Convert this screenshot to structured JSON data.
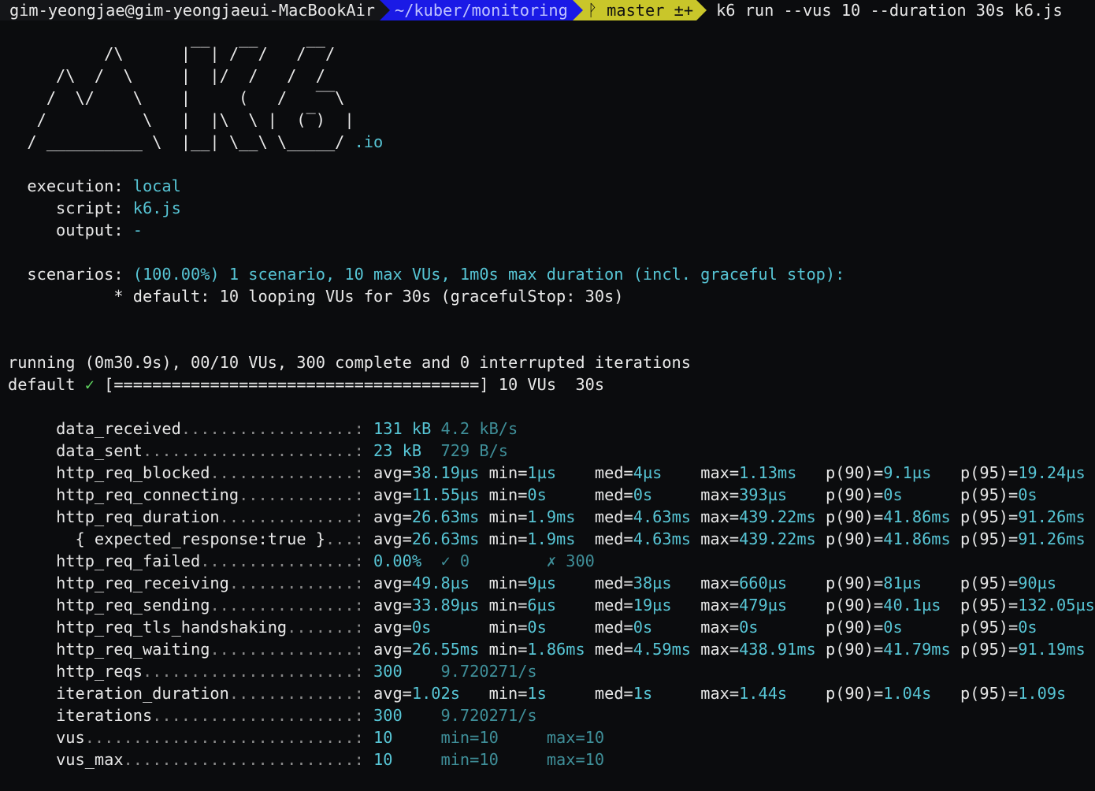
{
  "prompt": {
    "user_host": "gim-yeongjae@gim-yeongjaeui-MacBookAir",
    "path": "~/kuber/monitoring",
    "branch_icon": "git-branch-icon",
    "branch": "ᚹ master ±+",
    "command": "k6 run --vus 10 --duration 30s k6.js"
  },
  "logo": {
    "lines": [
      "          /\\      |‾‾| /‾‾/   /‾‾/",
      "     /\\  /  \\     |  |/  /   /  /",
      "    /  \\/    \\    |     (   /   ‾‾\\",
      "   /          \\   |  |\\  \\ |  (‾)  |",
      "  / __________ \\  |__| \\__\\ \\_____/"
    ],
    "suffix": ".io"
  },
  "summary": {
    "execution_label": "  execution:",
    "execution_value": "local",
    "script_label": "     script:",
    "script_value": "k6.js",
    "output_label": "     output:",
    "output_value": "-",
    "scenarios_label": "  scenarios:",
    "scenarios_value": "(100.00%) 1 scenario, 10 max VUs, 1m0s max duration (incl. graceful stop):",
    "scenario_detail": "           * default: 10 looping VUs for 30s (gracefulStop: 30s)"
  },
  "progress": {
    "running": "running (0m30.9s), 00/10 VUs, 300 complete and 0 interrupted iterations",
    "name": "default",
    "check": "✓",
    "bar": "[======================================]",
    "tail": " 10 VUs  30s",
    "fraction": 1.0
  },
  "metrics": [
    {
      "name": "data_received",
      "dots": "..................:",
      "cols": [
        {
          "t": "131 kB",
          "w": 7,
          "cls": "c"
        },
        {
          "t": "4.2 kB/s",
          "w": 0,
          "cls": "d"
        }
      ]
    },
    {
      "name": "data_sent",
      "dots": "......................:",
      "cols": [
        {
          "t": "23 kB",
          "w": 7,
          "cls": "c"
        },
        {
          "t": "729 B/s",
          "w": 0,
          "cls": "d"
        }
      ]
    },
    {
      "name": "http_req_blocked",
      "dots": "...............:",
      "cols": [
        {
          "k": "avg=",
          "v": "38.19µs",
          "w": 12
        },
        {
          "k": "min=",
          "v": "1µs",
          "w": 11
        },
        {
          "k": "med=",
          "v": "4µs",
          "w": 11
        },
        {
          "k": "max=",
          "v": "1.13ms",
          "w": 13
        },
        {
          "k": "p(90)=",
          "v": "9.1µs",
          "w": 14
        },
        {
          "k": "p(95)=",
          "v": "19.24µs",
          "w": 0
        }
      ]
    },
    {
      "name": "http_req_connecting",
      "dots": "............:",
      "cols": [
        {
          "k": "avg=",
          "v": "11.55µs",
          "w": 12
        },
        {
          "k": "min=",
          "v": "0s",
          "w": 11
        },
        {
          "k": "med=",
          "v": "0s",
          "w": 11
        },
        {
          "k": "max=",
          "v": "393µs",
          "w": 13
        },
        {
          "k": "p(90)=",
          "v": "0s",
          "w": 14
        },
        {
          "k": "p(95)=",
          "v": "0s",
          "w": 0
        }
      ]
    },
    {
      "name": "http_req_duration",
      "dots": "..............:",
      "cols": [
        {
          "k": "avg=",
          "v": "26.63ms",
          "w": 12
        },
        {
          "k": "min=",
          "v": "1.9ms",
          "w": 11
        },
        {
          "k": "med=",
          "v": "4.63ms",
          "w": 11
        },
        {
          "k": "max=",
          "v": "439.22ms",
          "w": 13
        },
        {
          "k": "p(90)=",
          "v": "41.86ms",
          "w": 14
        },
        {
          "k": "p(95)=",
          "v": "91.26ms",
          "w": 0
        }
      ]
    },
    {
      "name": "  { expected_response:true }",
      "dots": "...:",
      "cols": [
        {
          "k": "avg=",
          "v": "26.63ms",
          "w": 12
        },
        {
          "k": "min=",
          "v": "1.9ms",
          "w": 11
        },
        {
          "k": "med=",
          "v": "4.63ms",
          "w": 11
        },
        {
          "k": "max=",
          "v": "439.22ms",
          "w": 13
        },
        {
          "k": "p(90)=",
          "v": "41.86ms",
          "w": 14
        },
        {
          "k": "p(95)=",
          "v": "91.26ms",
          "w": 0
        }
      ]
    },
    {
      "name": "http_req_failed",
      "dots": "................:",
      "cols": [
        {
          "t": "0.00%",
          "w": 7,
          "cls": "c"
        },
        {
          "t": "✓ 0",
          "w": 11,
          "cls": "d"
        },
        {
          "t": "✗ 300",
          "w": 0,
          "cls": "d"
        }
      ]
    },
    {
      "name": "http_req_receiving",
      "dots": ".............:",
      "cols": [
        {
          "k": "avg=",
          "v": "49.8µs",
          "w": 12
        },
        {
          "k": "min=",
          "v": "9µs",
          "w": 11
        },
        {
          "k": "med=",
          "v": "38µs",
          "w": 11
        },
        {
          "k": "max=",
          "v": "660µs",
          "w": 13
        },
        {
          "k": "p(90)=",
          "v": "81µs",
          "w": 14
        },
        {
          "k": "p(95)=",
          "v": "90µs",
          "w": 0
        }
      ]
    },
    {
      "name": "http_req_sending",
      "dots": "...............:",
      "cols": [
        {
          "k": "avg=",
          "v": "33.89µs",
          "w": 12
        },
        {
          "k": "min=",
          "v": "6µs",
          "w": 11
        },
        {
          "k": "med=",
          "v": "19µs",
          "w": 11
        },
        {
          "k": "max=",
          "v": "479µs",
          "w": 13
        },
        {
          "k": "p(90)=",
          "v": "40.1µs",
          "w": 14
        },
        {
          "k": "p(95)=",
          "v": "132.05µs",
          "w": 0
        }
      ]
    },
    {
      "name": "http_req_tls_handshaking",
      "dots": ".......:",
      "cols": [
        {
          "k": "avg=",
          "v": "0s",
          "w": 12
        },
        {
          "k": "min=",
          "v": "0s",
          "w": 11
        },
        {
          "k": "med=",
          "v": "0s",
          "w": 11
        },
        {
          "k": "max=",
          "v": "0s",
          "w": 13
        },
        {
          "k": "p(90)=",
          "v": "0s",
          "w": 14
        },
        {
          "k": "p(95)=",
          "v": "0s",
          "w": 0
        }
      ]
    },
    {
      "name": "http_req_waiting",
      "dots": "...............:",
      "cols": [
        {
          "k": "avg=",
          "v": "26.55ms",
          "w": 12
        },
        {
          "k": "min=",
          "v": "1.86ms",
          "w": 11
        },
        {
          "k": "med=",
          "v": "4.59ms",
          "w": 11
        },
        {
          "k": "max=",
          "v": "438.91ms",
          "w": 13
        },
        {
          "k": "p(90)=",
          "v": "41.79ms",
          "w": 14
        },
        {
          "k": "p(95)=",
          "v": "91.19ms",
          "w": 0
        }
      ]
    },
    {
      "name": "http_reqs",
      "dots": "......................:",
      "cols": [
        {
          "t": "300",
          "w": 7,
          "cls": "c"
        },
        {
          "t": "9.720271/s",
          "w": 0,
          "cls": "d"
        }
      ]
    },
    {
      "name": "iteration_duration",
      "dots": ".............:",
      "cols": [
        {
          "k": "avg=",
          "v": "1.02s",
          "w": 12
        },
        {
          "k": "min=",
          "v": "1s",
          "w": 11
        },
        {
          "k": "med=",
          "v": "1s",
          "w": 11
        },
        {
          "k": "max=",
          "v": "1.44s",
          "w": 13
        },
        {
          "k": "p(90)=",
          "v": "1.04s",
          "w": 14
        },
        {
          "k": "p(95)=",
          "v": "1.09s",
          "w": 0
        }
      ]
    },
    {
      "name": "iterations",
      "dots": ".....................:",
      "cols": [
        {
          "t": "300",
          "w": 7,
          "cls": "c"
        },
        {
          "t": "9.720271/s",
          "w": 0,
          "cls": "d"
        }
      ]
    },
    {
      "name": "vus",
      "dots": "............................:",
      "cols": [
        {
          "t": "10",
          "w": 7,
          "cls": "c"
        },
        {
          "t": "min=10",
          "w": 11,
          "cls": "d"
        },
        {
          "t": "max=10",
          "w": 0,
          "cls": "d"
        }
      ]
    },
    {
      "name": "vus_max",
      "dots": "........................:",
      "cols": [
        {
          "t": "10",
          "w": 7,
          "cls": "c"
        },
        {
          "t": "min=10",
          "w": 11,
          "cls": "d"
        },
        {
          "t": "max=10",
          "w": 0,
          "cls": "d"
        }
      ]
    }
  ],
  "colors": {
    "background": "#0b0c0e",
    "text": "#e8e8e8",
    "value_cyan": "#57c5d5",
    "value_dim_cyan": "#3f8f99",
    "check_green": "#5fd35f",
    "prompt_path_bg": "#1a1ae6",
    "prompt_git_bg": "#c9c62a"
  }
}
